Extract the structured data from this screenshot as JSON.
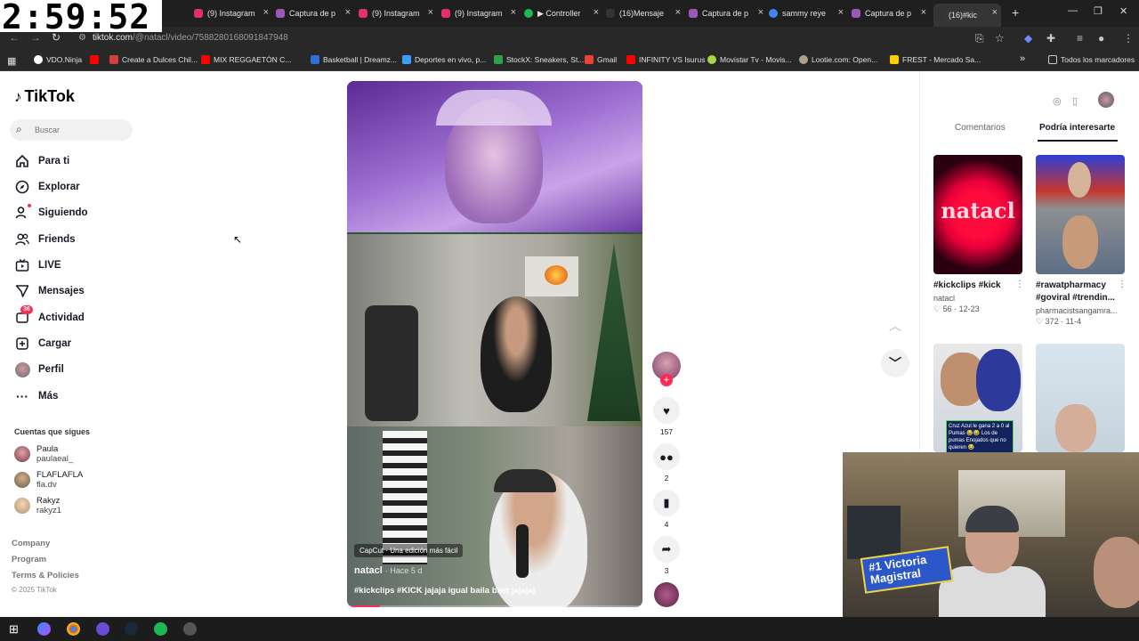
{
  "clock": "2:59:52",
  "browser": {
    "tabs": [
      {
        "label": "(9) Instagram",
        "color": "#e1306c"
      },
      {
        "label": "Captura de p",
        "color": "#9b59b6"
      },
      {
        "label": "(9) Instagram",
        "color": "#e1306c"
      },
      {
        "label": "(9) Instagram",
        "color": "#e1306c"
      },
      {
        "label": "▶ Controller",
        "color": "#1db954"
      },
      {
        "label": "(16)Mensaje",
        "color": "#161823"
      },
      {
        "label": "Captura de p",
        "color": "#9b59b6"
      },
      {
        "label": "sammy reye",
        "color": "#4285f4"
      },
      {
        "label": "Captura de p",
        "color": "#9b59b6"
      },
      {
        "label": "(16)#kic",
        "color": "#161823"
      }
    ],
    "url_host": "tiktok.com",
    "url_path": "/@natacl/video/7588280168091847948",
    "bookmarks": [
      {
        "label": "VDO.Ninja",
        "color": "#ffffff"
      },
      {
        "label": "",
        "color": "#ff0000"
      },
      {
        "label": "Create a Dulces Chil...",
        "color": "#d04040"
      },
      {
        "label": "MIX REGGAETÓN C...",
        "color": "#ff0000"
      },
      {
        "label": "Basketball | Dreamz...",
        "color": "#2f6fd8"
      },
      {
        "label": "Deportes en vivo, p...",
        "color": "#3aa0ff"
      },
      {
        "label": "StockX: Sneakers, St...",
        "color": "#2ca24a"
      },
      {
        "label": "Gmail",
        "color": "#ea4335"
      },
      {
        "label": "INFINITY VS Isurus",
        "color": "#ff0000"
      },
      {
        "label": "Movistar Tv - Movis...",
        "color": "#a8d64a"
      },
      {
        "label": "Lootie.com: Open...",
        "color": "#b0a090"
      },
      {
        "label": "FREST - Mercado Sa...",
        "color": "#ffcc00"
      }
    ],
    "all_bookmarks": "Todos los marcadores"
  },
  "sidebar": {
    "logo": "TikTok",
    "search_placeholder": "Buscar",
    "nav": [
      {
        "label": "Para ti",
        "icon": "home-icon"
      },
      {
        "label": "Explorar",
        "icon": "compass-icon"
      },
      {
        "label": "Siguiendo",
        "icon": "following-icon"
      },
      {
        "label": "Friends",
        "icon": "friends-icon"
      },
      {
        "label": "LIVE",
        "icon": "live-icon"
      },
      {
        "label": "Mensajes",
        "icon": "messages-icon"
      },
      {
        "label": "Actividad",
        "icon": "activity-icon",
        "badge": "36"
      },
      {
        "label": "Cargar",
        "icon": "upload-icon"
      },
      {
        "label": "Perfil",
        "icon": "avatar"
      },
      {
        "label": "Más",
        "icon": "more-icon"
      }
    ],
    "following_title": "Cuentas que sigues",
    "following": [
      {
        "name": "Paula",
        "handle": "paulaeal_"
      },
      {
        "name": "FLAFLAFLA",
        "handle": "fla.dv"
      },
      {
        "name": "Rakyz",
        "handle": "rakyz1"
      }
    ],
    "footer": [
      "Company",
      "Program",
      "Terms & Policies"
    ],
    "copyright": "© 2025 TikTok"
  },
  "video": {
    "capcut_label": "CapCut · Una edición más fácil",
    "author": "natacl",
    "time": "· Hace 5 d",
    "caption": "#kickclips #KICK jajaja igual baila bien jajajaj",
    "progress": 0.11,
    "likes": "157",
    "comments": "2",
    "saves": "4",
    "shares": "3"
  },
  "right": {
    "tabs": [
      "Comentarios",
      "Podría interesarte"
    ],
    "cards": [
      {
        "title": "#kickclips #kick",
        "author": "natacl",
        "likes": "56",
        "date": "12-23",
        "thumb_text": "natacl"
      },
      {
        "title": "#rawatpharmacy #goviral #trendin...",
        "author": "pharmacistsangamra...",
        "likes": "372",
        "date": "11-4",
        "thumb_text": ""
      },
      {
        "title": "",
        "author": "",
        "likes": "",
        "date": "",
        "thumb_text": "Cruz Azul le gana 2 a 0 al Pumas 😂😂 Los de pumas Enojados que no quieren 😂"
      },
      {
        "title": "",
        "author": "",
        "likes": "",
        "date": "",
        "thumb_text": ""
      }
    ]
  },
  "webcam": {
    "sign_text": "#1 Victoria Magistral"
  },
  "colors": {
    "accent": "#fe2c55",
    "text": "#161823"
  }
}
